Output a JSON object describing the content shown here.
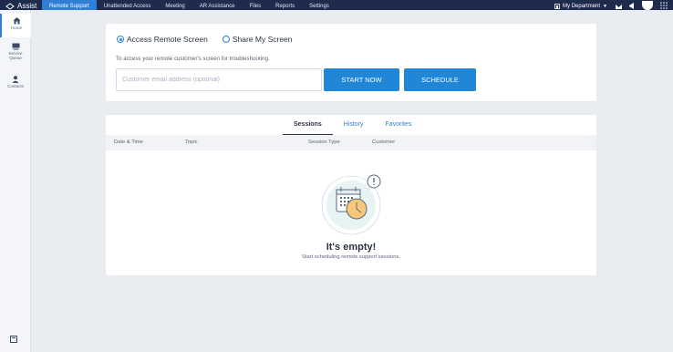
{
  "app": {
    "brand": "Assist"
  },
  "nav": {
    "tabs": [
      "Remote Support",
      "Unattended Access",
      "Meeting",
      "AR Assistance",
      "Files",
      "Reports",
      "Settings"
    ],
    "active_tab": 0,
    "department": "My Department"
  },
  "sidebar": {
    "items": [
      {
        "label": "Home",
        "icon": "home-icon"
      },
      {
        "label": "Service Queue",
        "icon": "service-queue-icon"
      },
      {
        "label": "Contacts",
        "icon": "contacts-icon"
      }
    ]
  },
  "connect": {
    "radio_access": "Access Remote Screen",
    "radio_share": "Share My Screen",
    "selected": "access",
    "hint": "To access your remote customer's screen for troubleshooting.",
    "email_placeholder": "Customer email address (optional)",
    "email_value": "",
    "start_button": "START NOW",
    "schedule_button": "SCHEDULE"
  },
  "sessions": {
    "tabs": [
      "Sessions",
      "History",
      "Favorites"
    ],
    "active_tab": 0,
    "columns": [
      "Date & Time",
      "Topic",
      "Session Type",
      "Customer"
    ],
    "empty_title": "It's empty!",
    "empty_subtitle": "Start scheduling remote support sessions."
  },
  "colors": {
    "topbar": "#1e2b4d",
    "accent": "#2f7fd6",
    "button": "#1f86d8",
    "background": "#e9ecf1"
  }
}
